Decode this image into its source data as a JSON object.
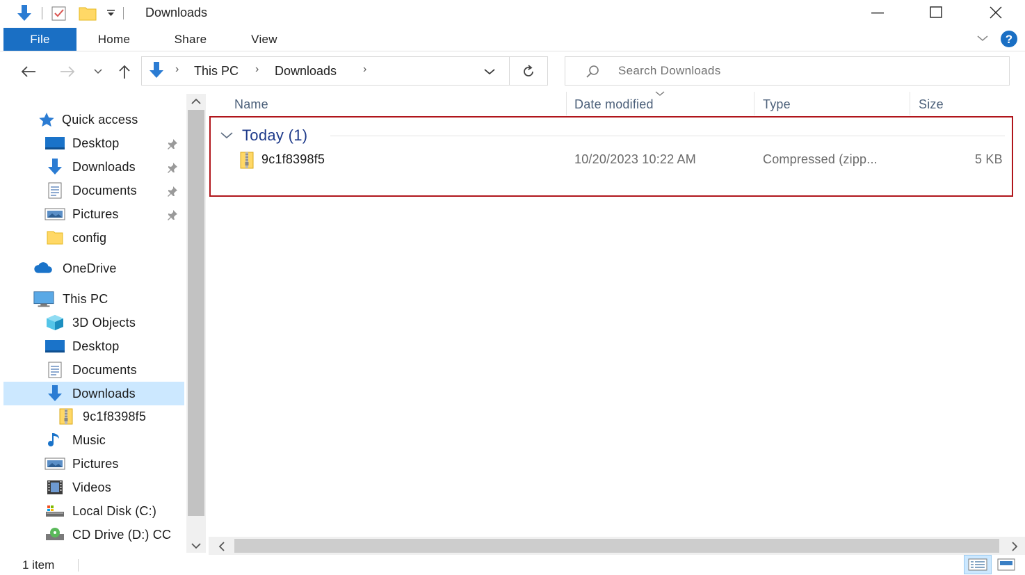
{
  "window": {
    "title": "Downloads"
  },
  "ribbon": {
    "tabs": [
      "File",
      "Home",
      "Share",
      "View"
    ]
  },
  "address": {
    "crumbs": [
      "This PC",
      "Downloads"
    ]
  },
  "search": {
    "placeholder": "Search Downloads"
  },
  "nav_pane": {
    "quick_access": {
      "label": "Quick access",
      "items": [
        {
          "label": "Desktop",
          "icon": "desktop-icon",
          "pinned": true
        },
        {
          "label": "Downloads",
          "icon": "downloads-icon",
          "pinned": true
        },
        {
          "label": "Documents",
          "icon": "documents-icon",
          "pinned": true
        },
        {
          "label": "Pictures",
          "icon": "pictures-icon",
          "pinned": true
        },
        {
          "label": "config",
          "icon": "folder-icon",
          "pinned": false
        }
      ]
    },
    "onedrive": {
      "label": "OneDrive"
    },
    "this_pc": {
      "label": "This PC",
      "items": [
        {
          "label": "3D Objects",
          "icon": "3d-objects-icon"
        },
        {
          "label": "Desktop",
          "icon": "desktop-icon"
        },
        {
          "label": "Documents",
          "icon": "documents-icon"
        },
        {
          "label": "Downloads",
          "icon": "downloads-icon",
          "selected": true
        },
        {
          "label": "9c1f8398f5",
          "icon": "zip-folder-icon",
          "child": true
        },
        {
          "label": "Music",
          "icon": "music-icon"
        },
        {
          "label": "Pictures",
          "icon": "pictures-icon"
        },
        {
          "label": "Videos",
          "icon": "videos-icon"
        },
        {
          "label": "Local Disk (C:)",
          "icon": "local-disk-icon"
        },
        {
          "label": "CD Drive (D:) CC",
          "icon": "cd-drive-icon"
        }
      ]
    }
  },
  "columns": {
    "name": "Name",
    "date_modified": "Date modified",
    "type": "Type",
    "size": "Size"
  },
  "group": {
    "title": "Today (1)"
  },
  "files": [
    {
      "name": "9c1f8398f5",
      "date_modified": "10/20/2023 10:22 AM",
      "type": "Compressed (zipp...",
      "size": "5 KB"
    }
  ],
  "status": {
    "count": "1 item"
  },
  "colors": {
    "accent": "#1a6fc4",
    "selection": "#cce8ff",
    "highlight_box": "#b0151b"
  }
}
